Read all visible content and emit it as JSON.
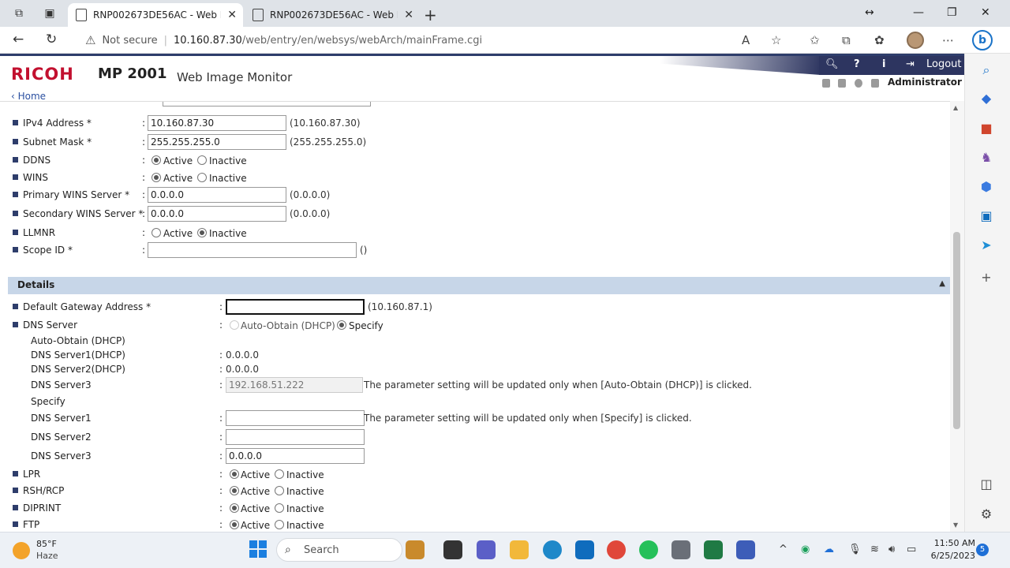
{
  "browser": {
    "tabs": [
      {
        "title": "RNP002673DE56AC - Web Image Monitor"
      },
      {
        "title": "RNP002673DE56AC - Web Image Monitor"
      }
    ],
    "not_secure": "Not secure",
    "url_host": "10.160.87.30",
    "url_path": "/web/entry/en/websys/webArch/mainFrame.cgi"
  },
  "header": {
    "brand": "RICOH",
    "model": "MP 2001",
    "title": "Web Image Monitor",
    "logout": "Logout",
    "user": "Administrator",
    "home": "Home"
  },
  "rows": [
    {
      "label": "IPv4 Address *",
      "value": "10.160.87.30",
      "hint": "(10.160.87.30)"
    },
    {
      "label": "Subnet Mask *",
      "value": "255.255.255.0",
      "hint": "(255.255.255.0)"
    },
    {
      "label": "DDNS",
      "active": "Active",
      "inactive": "Inactive"
    },
    {
      "label": "WINS",
      "active": "Active",
      "inactive": "Inactive"
    },
    {
      "label": "Primary WINS Server *",
      "value": "0.0.0.0",
      "hint": "(0.0.0.0)"
    },
    {
      "label": "Secondary WINS Server *",
      "value": "0.0.0.0",
      "hint": "(0.0.0.0)"
    },
    {
      "label": "LLMNR",
      "active": "Active",
      "inactive": "Inactive"
    },
    {
      "label": "Scope ID *",
      "value": "",
      "hint": "()"
    }
  ],
  "details": {
    "title": "Details",
    "gateway": {
      "label": "Default Gateway Address *",
      "value": "",
      "hint": "(10.160.87.1)"
    },
    "dns": {
      "label": "DNS Server",
      "auto_option": "Auto-Obtain (DHCP)",
      "specify_option": "Specify",
      "auto_heading": "Auto-Obtain (DHCP)",
      "server1_dhcp": {
        "label": "DNS Server1(DHCP)",
        "value": "0.0.0.0"
      },
      "server2_dhcp": {
        "label": "DNS Server2(DHCP)",
        "value": "0.0.0.0"
      },
      "server3_auto": {
        "label": "DNS Server3",
        "value": "192.168.51.222",
        "note": "The parameter setting will be updated only when [Auto-Obtain (DHCP)] is clicked."
      },
      "specify_heading": "Specify",
      "server1": {
        "label": "DNS Server1",
        "value": "",
        "note": "The parameter setting will be updated only when [Specify] is clicked."
      },
      "server2": {
        "label": "DNS Server2",
        "value": ""
      },
      "server3": {
        "label": "DNS Server3",
        "value": "0.0.0.0"
      }
    },
    "protocols": [
      {
        "label": "LPR",
        "active": "Active",
        "inactive": "Inactive"
      },
      {
        "label": "RSH/RCP",
        "active": "Active",
        "inactive": "Inactive"
      },
      {
        "label": "DIPRINT",
        "active": "Active",
        "inactive": "Inactive"
      },
      {
        "label": "FTP",
        "active": "Active",
        "inactive": "Inactive"
      }
    ]
  },
  "taskbar": {
    "temp": "85°F",
    "weather": "Haze",
    "search": "Search",
    "time": "11:50 AM",
    "date": "6/25/2023",
    "notifications": "5"
  },
  "colors": {
    "brand_red": "#c2102f",
    "nav_blue": "#2d3560",
    "section_bg": "#c7d6e8"
  }
}
